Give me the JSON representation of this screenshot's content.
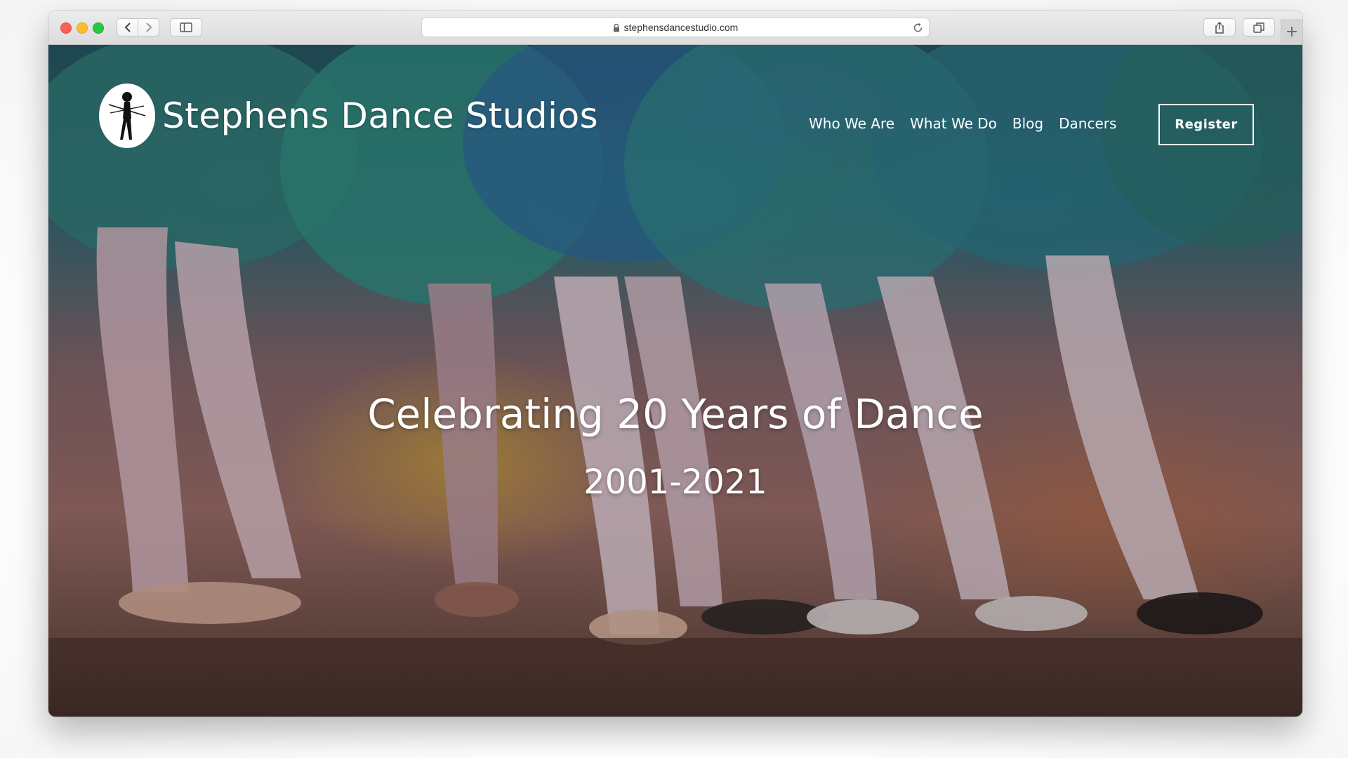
{
  "browser": {
    "url": "stephensdancestudio.com",
    "icons": {
      "back": "chevron-left-icon",
      "forward": "chevron-right-icon",
      "sidebar": "sidebar-icon",
      "lock": "lock-icon",
      "reload": "reload-icon",
      "share": "share-icon",
      "tabs": "tabs-icon",
      "new_tab": "plus-icon"
    },
    "new_tab_glyph": "+"
  },
  "site": {
    "title": "Stephens Dance Studios",
    "logo": "dancer-logo-icon",
    "nav": [
      {
        "label": "Who We Are"
      },
      {
        "label": "What We Do"
      },
      {
        "label": "Blog"
      },
      {
        "label": "Dancers"
      }
    ],
    "register_label": "Register"
  },
  "hero": {
    "headline": "Celebrating 20 Years of Dance",
    "subhead": "2001-2021",
    "image": "ballet-dancers-legs-tutus-photo"
  },
  "colors": {
    "traffic_red": "#fc5f57",
    "traffic_yellow": "#fdbc2e",
    "traffic_green": "#28c840",
    "hero_text": "#ffffff"
  }
}
